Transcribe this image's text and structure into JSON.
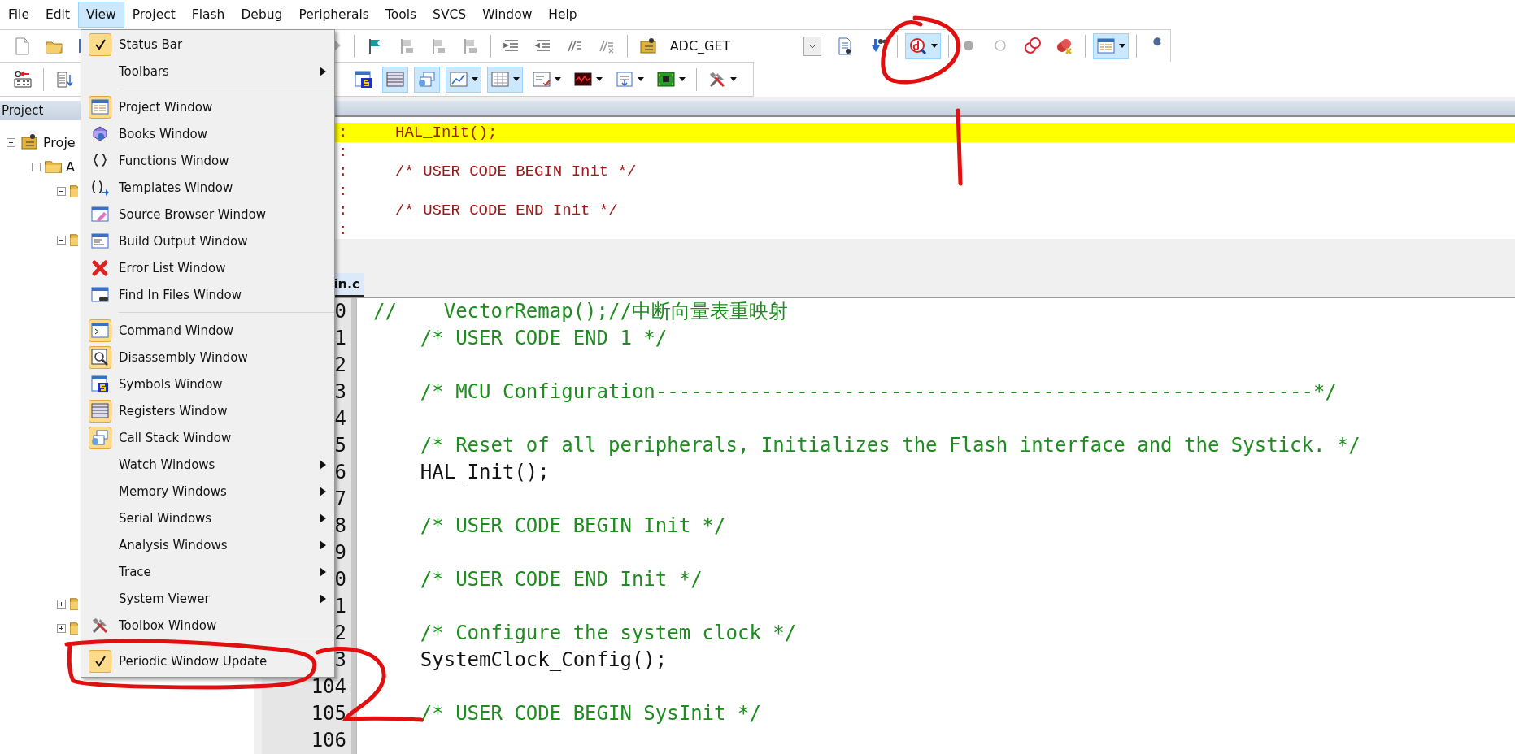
{
  "menu_bar": [
    {
      "label": "File",
      "selected": false
    },
    {
      "label": "Edit",
      "selected": false
    },
    {
      "label": "View",
      "selected": true
    },
    {
      "label": "Project",
      "selected": false
    },
    {
      "label": "Flash",
      "selected": false
    },
    {
      "label": "Debug",
      "selected": false
    },
    {
      "label": "Peripherals",
      "selected": false
    },
    {
      "label": "Tools",
      "selected": false
    },
    {
      "label": "SVCS",
      "selected": false
    },
    {
      "label": "Window",
      "selected": false
    },
    {
      "label": "Help",
      "selected": false
    }
  ],
  "toolbar": {
    "target": "ADC_GET"
  },
  "project_panel": {
    "title": "Project",
    "tree": [
      {
        "label": "Proje",
        "expanded": true,
        "children": [
          {
            "label": "A",
            "expanded": true,
            "children": [
              {
                "expanded": true
              },
              {
                "expanded": true
              },
              {
                "expanded": false
              },
              {
                "expanded": false
              }
            ]
          }
        ]
      }
    ]
  },
  "disassembly": {
    "rows": [
      {
        "marker": ":",
        "text": "HAL_Init();",
        "current": true
      },
      {
        "marker": ":",
        "current": false
      },
      {
        "marker": ":",
        "text": "/* USER CODE BEGIN Init */",
        "current": false
      },
      {
        "marker": ":",
        "current": false
      },
      {
        "marker": ":",
        "text": "/* USER CODE END Init */",
        "current": false
      },
      {
        "marker": ":",
        "current": false
      }
    ]
  },
  "editor": {
    "tabs": [
      {
        "label": "in.c",
        "selected": true
      }
    ],
    "lines": [
      {
        "number": "0",
        "text": "//    VectorRemap();//中断向量表重映射",
        "kind": "comment"
      },
      {
        "number": "1",
        "text": "    /* USER CODE END 1 */",
        "kind": "comment"
      },
      {
        "number": "2"
      },
      {
        "number": "3",
        "text": "    /* MCU Configuration--------------------------------------------------------*/",
        "kind": "comment"
      },
      {
        "number": "4"
      },
      {
        "number": "5",
        "text": "    /* Reset of all peripherals, Initializes the Flash interface and the Systick. */",
        "kind": "comment"
      },
      {
        "number": "6",
        "text": "    HAL_Init();",
        "kind": "code"
      },
      {
        "number": "7"
      },
      {
        "number": "8",
        "text": "    /* USER CODE BEGIN Init */",
        "kind": "comment"
      },
      {
        "number": "9"
      },
      {
        "number": "0",
        "text": "    /* USER CODE END Init */",
        "kind": "comment"
      },
      {
        "number": "1"
      },
      {
        "number": "2",
        "text": "    /* Configure the system clock */",
        "kind": "comment"
      },
      {
        "number": "3",
        "text": "    SystemClock_Config();",
        "kind": "code"
      },
      {
        "number": "104"
      },
      {
        "number": "105",
        "text": "    /* USER CODE BEGIN SysInit */",
        "kind": "comment"
      },
      {
        "number": "106"
      }
    ]
  },
  "view_menu": [
    {
      "kind": "check",
      "label": "Status Bar",
      "checked": true
    },
    {
      "kind": "submenu",
      "label": "Toolbars"
    },
    {
      "kind": "separator"
    },
    {
      "kind": "window",
      "label": "Project Window",
      "active": true
    },
    {
      "kind": "window",
      "label": "Books Window",
      "active": false
    },
    {
      "kind": "window",
      "label": "Functions Window",
      "active": false
    },
    {
      "kind": "window",
      "label": "Templates Window",
      "active": false
    },
    {
      "kind": "window",
      "label": "Source Browser Window",
      "active": false
    },
    {
      "kind": "window",
      "label": "Build Output Window",
      "active": false
    },
    {
      "kind": "window",
      "label": "Error List Window",
      "active": false
    },
    {
      "kind": "window",
      "label": "Find In Files Window",
      "active": false
    },
    {
      "kind": "separator"
    },
    {
      "kind": "window",
      "label": "Command Window",
      "active": true
    },
    {
      "kind": "window",
      "label": "Disassembly Window",
      "active": true
    },
    {
      "kind": "window",
      "label": "Symbols Window",
      "active": false
    },
    {
      "kind": "window",
      "label": "Registers Window",
      "active": true
    },
    {
      "kind": "window",
      "label": "Call Stack Window",
      "active": true
    },
    {
      "kind": "submenu",
      "label": "Watch Windows"
    },
    {
      "kind": "submenu",
      "label": "Memory Windows"
    },
    {
      "kind": "submenu",
      "label": "Serial Windows"
    },
    {
      "kind": "submenu",
      "label": "Analysis Windows"
    },
    {
      "kind": "submenu",
      "label": "Trace"
    },
    {
      "kind": "submenu",
      "label": "System Viewer"
    },
    {
      "kind": "window",
      "label": "Toolbox Window",
      "active": false
    },
    {
      "kind": "separator"
    },
    {
      "kind": "check",
      "label": "Periodic Window Update",
      "checked": true
    }
  ]
}
